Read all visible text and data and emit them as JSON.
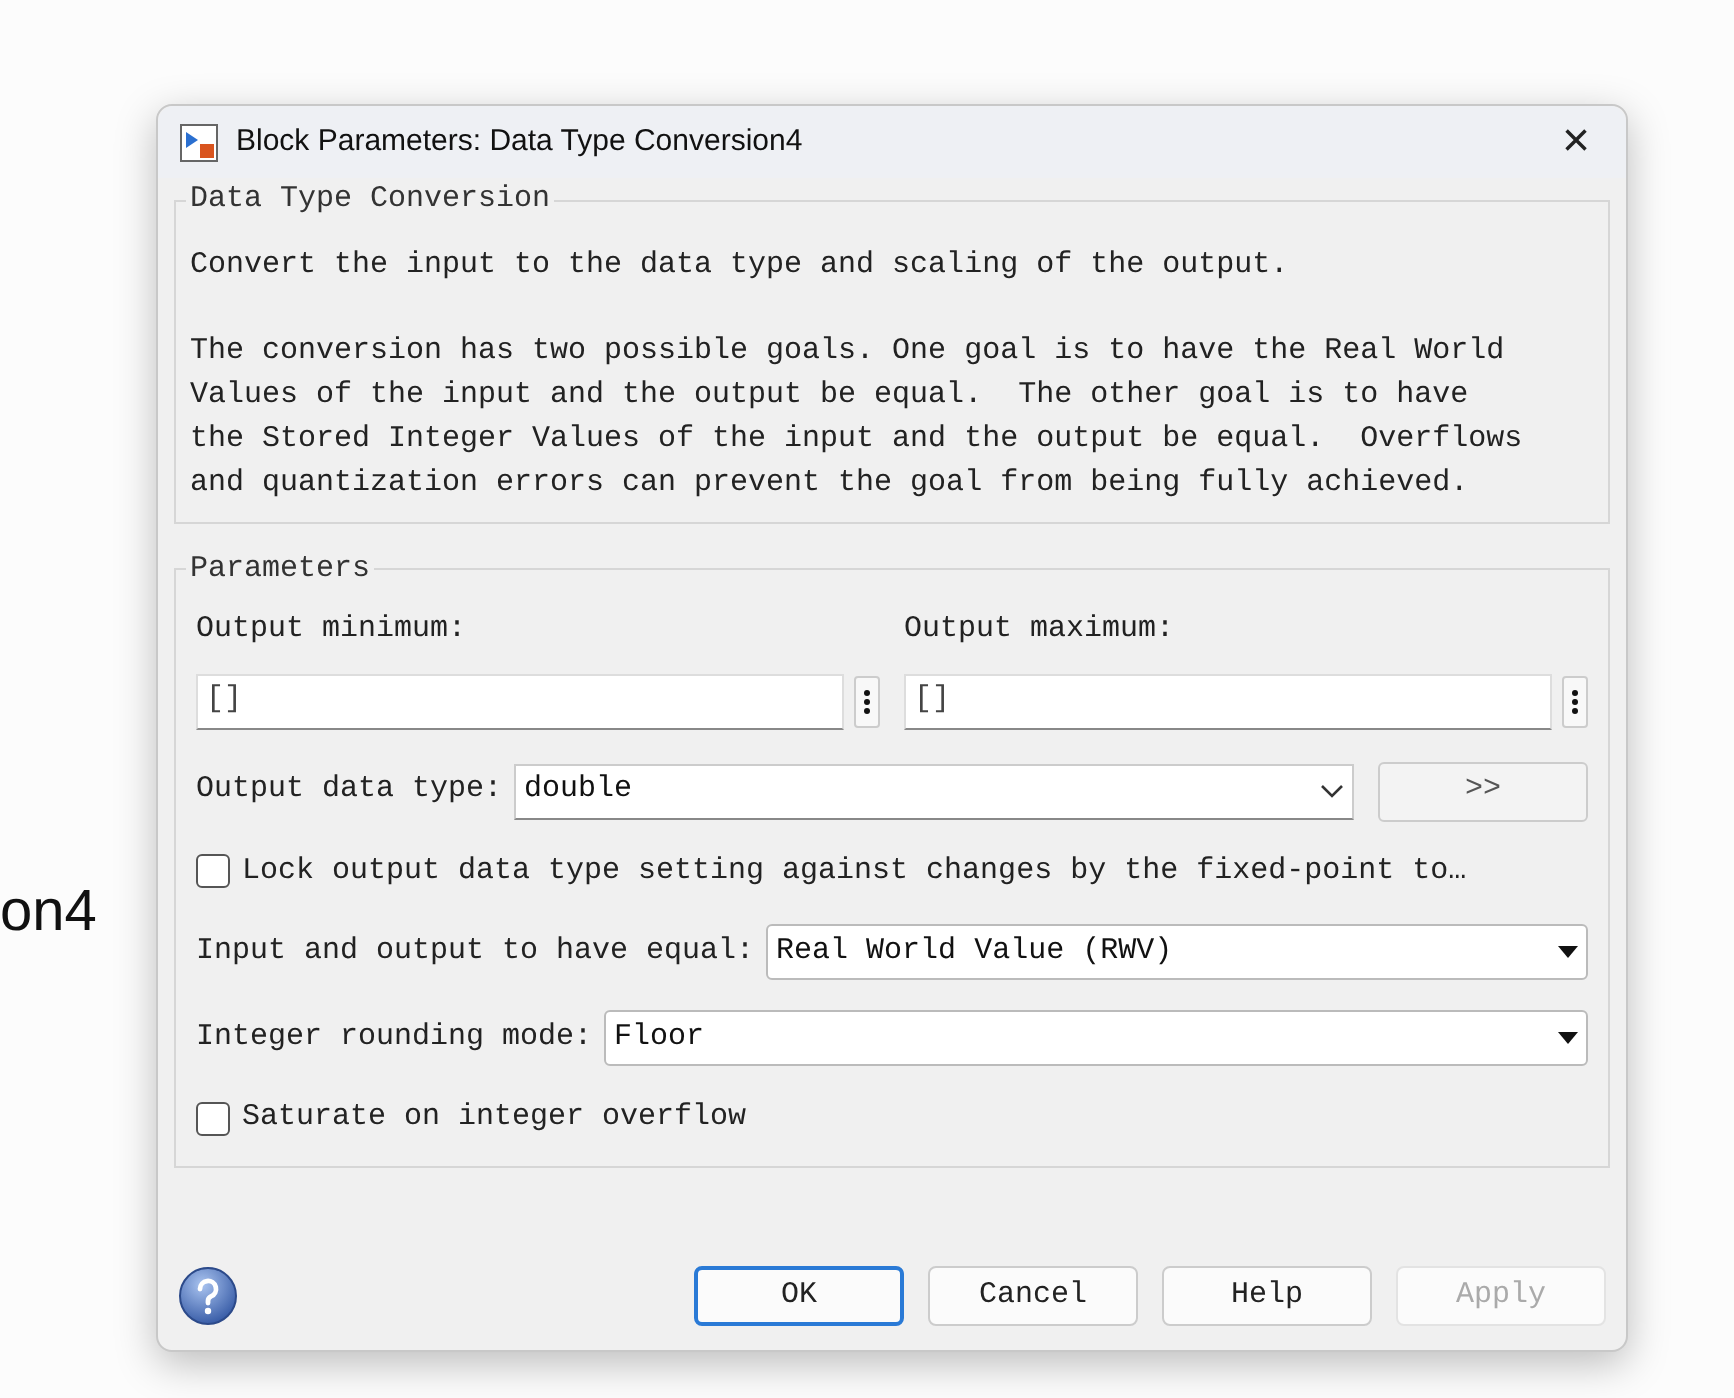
{
  "background_window": {
    "title_fragment": "on4"
  },
  "window": {
    "title": "Block Parameters: Data Type Conversion4",
    "close": "×"
  },
  "description_group": {
    "title": "Data Type Conversion",
    "paragraphs": [
      "Convert the input to the data type and scaling of the output.",
      "The conversion has two possible goals. One goal is to have the Real World\nValues of the input and the output be equal.  The other goal is to have\nthe Stored Integer Values of the input and the output be equal.  Overflows\nand quantization errors can prevent the goal from being fully achieved."
    ]
  },
  "parameters_group": {
    "title": "Parameters",
    "range_fields": [
      {
        "label": "Output minimum:",
        "value": "[]"
      },
      {
        "label": "Output maximum:",
        "value": "[]"
      }
    ],
    "data_type": {
      "label": "Output data type:",
      "value": "double",
      "assistant_button": ">>"
    },
    "rows": [
      {
        "kind": "checkbox",
        "label": "Lock output data type setting against changes by the fixed-point to…",
        "checked": false
      },
      {
        "kind": "select",
        "label": "Input and output to have equal:",
        "value": "Real World Value (RWV)"
      },
      {
        "kind": "select",
        "label": "Integer rounding mode:",
        "value": "Floor"
      },
      {
        "kind": "checkbox",
        "label": "Saturate on integer overflow",
        "checked": false
      }
    ]
  },
  "buttons": [
    {
      "label": "OK",
      "default": true,
      "disabled": false
    },
    {
      "label": "Cancel",
      "default": false,
      "disabled": false
    },
    {
      "label": "Help",
      "default": false,
      "disabled": false
    },
    {
      "label": "Apply",
      "default": false,
      "disabled": true
    }
  ]
}
